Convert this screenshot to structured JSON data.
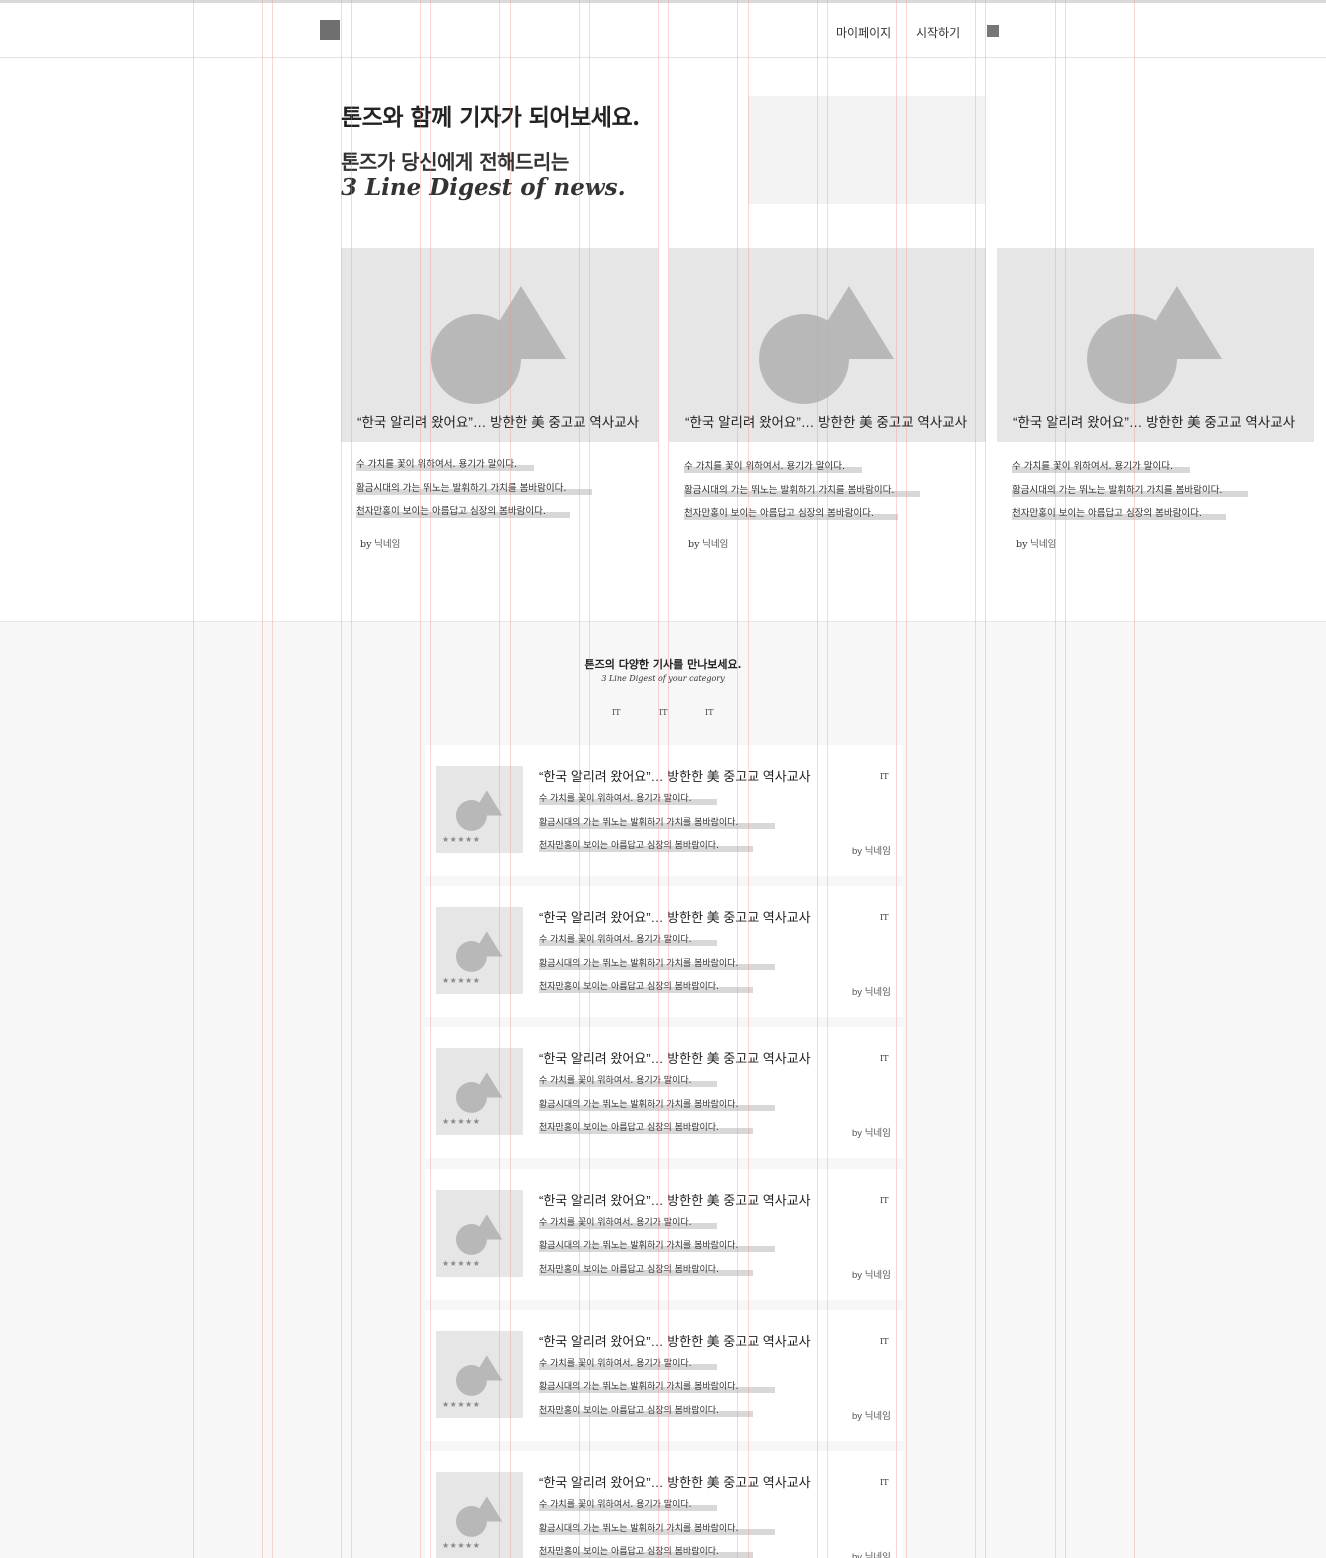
{
  "header": {
    "nav": {
      "mypage": "마이페이지",
      "start": "시작하기"
    }
  },
  "hero": {
    "title": "톤즈와 함께 기자가 되어보세요.",
    "subtitle_line1": "톤즈가 당신에게 전해드리는",
    "subtitle_line2": "3 Line Digest of news."
  },
  "featured": [
    {
      "title": "“한국 알리려 왔어요”… 방한한 美 중고교 역사교사",
      "lines": [
        "수 가치를 꽃이 위하여서. 용기가 말이다.",
        "황금시대의 가는 뛰노는 발휘하기 가치를 봄바람이다.",
        "천자만홍이 보이는 아름답고 심장의 봄바람이다."
      ],
      "by": "by",
      "author": "닉네임"
    },
    {
      "title": "“한국 알리려 왔어요”… 방한한 美 중고교 역사교사",
      "lines": [
        "수 가치를 꽃이 위하여서. 용기가 말이다.",
        "황금시대의 가는 뛰노는 발휘하기 가치를 봄바람이다.",
        "천자만홍이 보이는 아름답고 심장의 봄바람이다."
      ],
      "by": "by",
      "author": "닉네임"
    },
    {
      "title": "“한국 알리려 왔어요”… 방한한 美 중고교 역사교사",
      "lines": [
        "수 가치를 꽃이 위하여서. 용기가 말이다.",
        "황금시대의 가는 뛰노는 발휘하기 가치를 봄바람이다.",
        "천자만홍이 보이는 아름답고 심장의 봄바람이다."
      ],
      "by": "by",
      "author": "닉네임"
    }
  ],
  "category": {
    "title": "톤즈의 다양한 기사를 만나보세요.",
    "subtitle": "3 Line Digest of your category",
    "tabs": [
      "IT",
      "IT",
      "IT"
    ]
  },
  "articles": [
    {
      "title": "“한국 알리려 왔어요”… 방한한 美 중고교 역사교사",
      "tag": "IT",
      "stars": "★★★★★",
      "lines": [
        "수 가치를 꽃이 위하여서. 용기가 말이다.",
        "황금시대의 가는 뛰노는 발휘하기 가치를 봄바람이다.",
        "천자만홍이 보이는 아름답고 심장의 봄바람이다."
      ],
      "by": "by",
      "author": "닉네임"
    },
    {
      "title": "“한국 알리려 왔어요”… 방한한 美 중고교 역사교사",
      "tag": "IT",
      "stars": "★★★★★",
      "lines": [
        "수 가치를 꽃이 위하여서. 용기가 말이다.",
        "황금시대의 가는 뛰노는 발휘하기 가치를 봄바람이다.",
        "천자만홍이 보이는 아름답고 심장의 봄바람이다."
      ],
      "by": "by",
      "author": "닉네임"
    },
    {
      "title": "“한국 알리려 왔어요”… 방한한 美 중고교 역사교사",
      "tag": "IT",
      "stars": "★★★★★",
      "lines": [
        "수 가치를 꽃이 위하여서. 용기가 말이다.",
        "황금시대의 가는 뛰노는 발휘하기 가치를 봄바람이다.",
        "천자만홍이 보이는 아름답고 심장의 봄바람이다."
      ],
      "by": "by",
      "author": "닉네임"
    },
    {
      "title": "“한국 알리려 왔어요”… 방한한 美 중고교 역사교사",
      "tag": "IT",
      "stars": "★★★★★",
      "lines": [
        "수 가치를 꽃이 위하여서. 용기가 말이다.",
        "황금시대의 가는 뛰노는 발휘하기 가치를 봄바람이다.",
        "천자만홍이 보이는 아름답고 심장의 봄바람이다."
      ],
      "by": "by",
      "author": "닉네임"
    },
    {
      "title": "“한국 알리려 왔어요”… 방한한 美 중고교 역사교사",
      "tag": "IT",
      "stars": "★★★★★",
      "lines": [
        "수 가치를 꽃이 위하여서. 용기가 말이다.",
        "황금시대의 가는 뛰노는 발휘하기 가치를 봄바람이다.",
        "천자만홍이 보이는 아름답고 심장의 봄바람이다."
      ],
      "by": "by",
      "author": "닉네임"
    },
    {
      "title": "“한국 알리려 왔어요”… 방한한 美 중고교 역사교사",
      "tag": "IT",
      "stars": "★★★★★",
      "lines": [
        "수 가치를 꽃이 위하여서. 용기가 말이다.",
        "황금시대의 가는 뛰노는 발휘하기 가치를 봄바람이다.",
        "천자만홍이 보이는 아름답고 심장의 봄바람이다."
      ],
      "by": "by",
      "author": "닉네임"
    }
  ],
  "colors": {
    "placeholder": "#e6e6e6",
    "shape": "#b8b8b8",
    "highlight": "#d8d8d8",
    "guide": "#f08c8c"
  }
}
